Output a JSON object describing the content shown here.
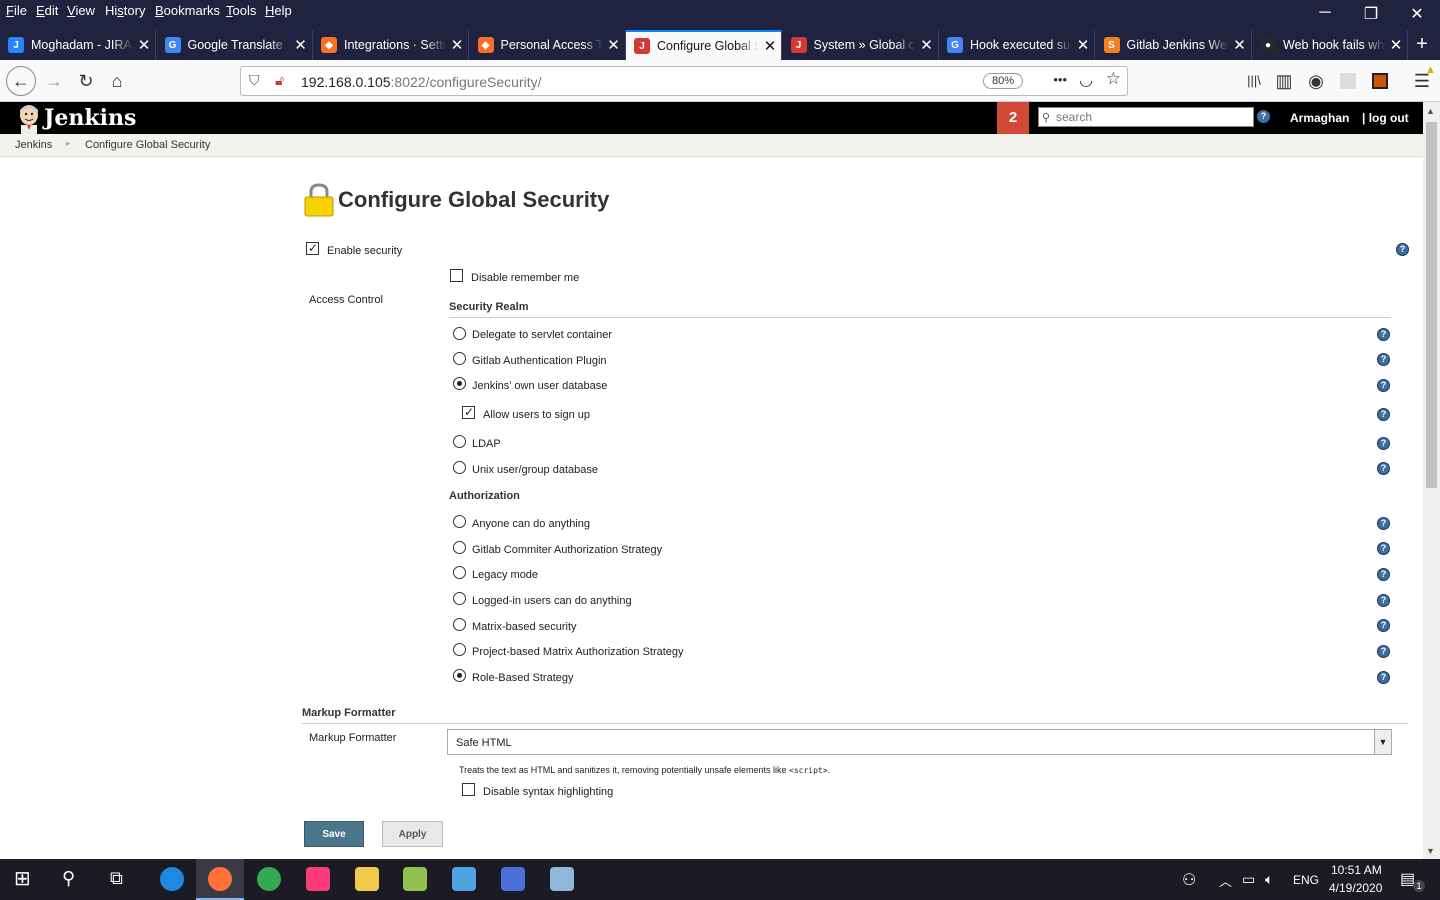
{
  "menubar": {
    "items": [
      "File",
      "Edit",
      "View",
      "History",
      "Bookmarks",
      "Tools",
      "Help"
    ],
    "underline": [
      "F",
      "E",
      "V",
      "s",
      "B",
      "T",
      "H"
    ]
  },
  "window_controls": {
    "minimize": "─",
    "restore": "❐",
    "close": "✕"
  },
  "tabs": [
    {
      "label": "Moghadam - JIRA",
      "icon_color": "#2684ff",
      "icon_glyph": "J"
    },
    {
      "label": "Google Translate",
      "icon_color": "#4285f4",
      "icon_glyph": "G"
    },
    {
      "label": "Integrations · Settings",
      "icon_color": "#fc6d26",
      "icon_glyph": "◆"
    },
    {
      "label": "Personal Access Tokens",
      "icon_color": "#fc6d26",
      "icon_glyph": "◆"
    },
    {
      "label": "Configure Global Security",
      "icon_color": "#d33833",
      "icon_glyph": "J"
    },
    {
      "label": "System » Global configuration",
      "icon_color": "#d33833",
      "icon_glyph": "J"
    },
    {
      "label": "Hook executed successfully",
      "icon_color": "#4285f4",
      "icon_glyph": "G"
    },
    {
      "label": "Gitlab Jenkins Webhook",
      "icon_color": "#f48024",
      "icon_glyph": "S"
    },
    {
      "label": "Web hook fails when",
      "icon_color": "#24292e",
      "icon_glyph": "●"
    }
  ],
  "tab_close": "✕",
  "new_tab": "+",
  "nav": {
    "back": "←",
    "forward": "→",
    "reload": "↻",
    "home": "⌂",
    "url_host": "192.168.0.105",
    "url_rest": ":8022/configureSecurity/",
    "zoom": "80%",
    "more": "•••",
    "pocket": "◡",
    "star": "☆",
    "library": "|||\\",
    "sidebar": "▥",
    "account": "◉",
    "menu": "☰"
  },
  "jenkins": {
    "title": "Jenkins",
    "notification_count": "2",
    "search_placeholder": "search",
    "help": "?",
    "user": "Armaghan",
    "logout": "| log out"
  },
  "breadcrumb": {
    "root": "Jenkins",
    "separator": "▸",
    "current": "Configure Global Security"
  },
  "page": {
    "title": "Configure Global Security",
    "enable_security": {
      "label": "Enable security",
      "checked": true
    },
    "disable_remember_me": {
      "label": "Disable remember me",
      "checked": false
    },
    "access_control_label": "Access Control",
    "security_realm": {
      "heading": "Security Realm",
      "options": [
        {
          "label": "Delegate to servlet container",
          "selected": false
        },
        {
          "label": "Gitlab Authentication Plugin",
          "selected": false
        },
        {
          "label": "Jenkins’ own user database",
          "selected": true
        },
        {
          "label": "LDAP",
          "selected": false
        },
        {
          "label": "Unix user/group database",
          "selected": false
        }
      ],
      "allow_signup": {
        "label": "Allow users to sign up",
        "checked": true
      }
    },
    "authorization": {
      "heading": "Authorization",
      "options": [
        {
          "label": "Anyone can do anything",
          "selected": false
        },
        {
          "label": "Gitlab Commiter Authorization Strategy",
          "selected": false
        },
        {
          "label": "Legacy mode",
          "selected": false
        },
        {
          "label": "Logged-in users can do anything",
          "selected": false
        },
        {
          "label": "Matrix-based security",
          "selected": false
        },
        {
          "label": "Project-based Matrix Authorization Strategy",
          "selected": false
        },
        {
          "label": "Role-Based Strategy",
          "selected": true
        }
      ]
    },
    "markup_formatter": {
      "heading": "Markup Formatter",
      "label": "Markup Formatter",
      "selected": "Safe HTML",
      "description_prefix": "Treats the text as HTML and sanitizes it, removing potentially unsafe elements like ",
      "description_code": "<script>",
      "description_suffix": ".",
      "disable_syntax": {
        "label": "Disable syntax highlighting",
        "checked": false
      }
    },
    "save_label": "Save",
    "apply_label": "Apply",
    "help_glyph": "?"
  },
  "taskbar": {
    "start": "⊞",
    "search": "⚲",
    "taskview": "⧉",
    "apps": [
      {
        "name": "chrome-canary",
        "color": "#1e88e5"
      },
      {
        "name": "firefox",
        "color": "#ff7139"
      },
      {
        "name": "chrome",
        "color": "#34a853"
      },
      {
        "name": "intellij",
        "color": "#fc3c7a"
      },
      {
        "name": "file-explorer",
        "color": "#f2c94c"
      },
      {
        "name": "notepad-plus-plus",
        "color": "#90c24f"
      },
      {
        "name": "mobaxterm",
        "color": "#4fa3e0"
      },
      {
        "name": "network-app",
        "color": "#4b6fd6"
      },
      {
        "name": "paint-app",
        "color": "#8fb8d8"
      }
    ],
    "language": "ENG",
    "time": "10:51 AM",
    "date": "4/19/2020",
    "notifications": "1"
  }
}
